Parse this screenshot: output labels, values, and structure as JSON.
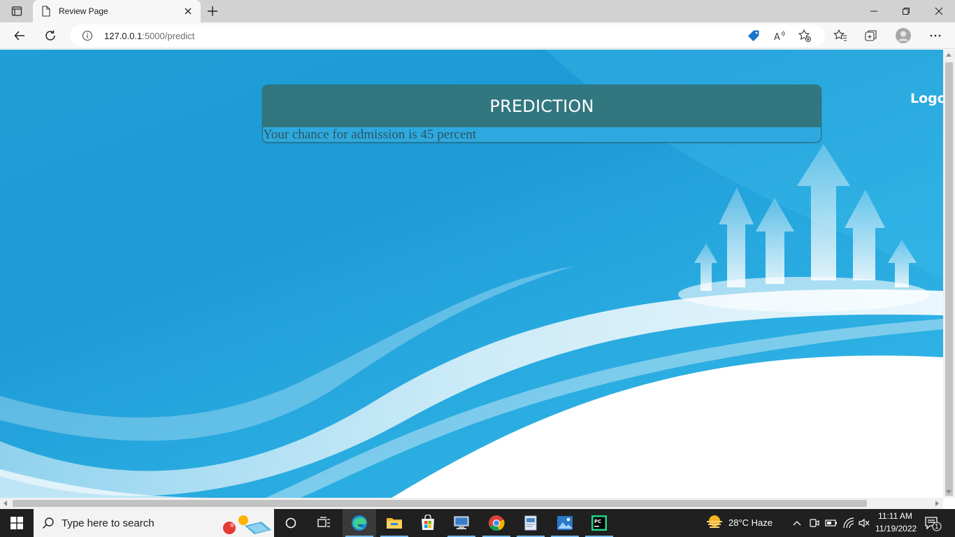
{
  "browser": {
    "tab_title": "Review Page",
    "url_host": "127.0.0.1",
    "url_path": ":5000/predict"
  },
  "page": {
    "card_title": "PREDICTION",
    "result_text": "Your chance for admission is 45 percent",
    "logout_label": "Logou"
  },
  "taskbar": {
    "search_placeholder": "Type here to search",
    "weather": "28°C  Haze",
    "time": "11:11 AM",
    "date": "11/19/2022",
    "notification_count": "1"
  },
  "colors": {
    "card_header": "#32777f",
    "page_bg": "#1f9fd6",
    "taskbar_bg": "#202020"
  }
}
